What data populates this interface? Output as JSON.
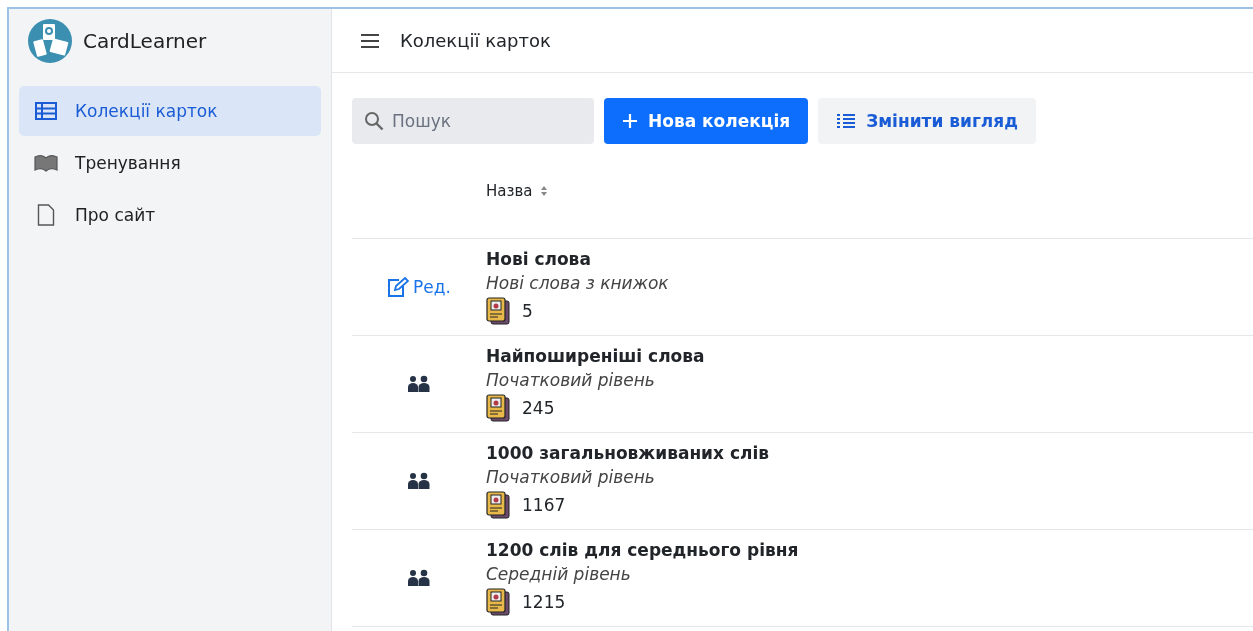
{
  "app": {
    "name": "CardLearner"
  },
  "sidebar": {
    "items": [
      {
        "label": "Колекції карток",
        "kind": "table",
        "selected": true
      },
      {
        "label": "Тренування",
        "kind": "book",
        "selected": false
      },
      {
        "label": "Про сайт",
        "kind": "page",
        "selected": false
      }
    ]
  },
  "header": {
    "title": "Колекції карток"
  },
  "toolbar": {
    "search": {
      "placeholder": "Пошук"
    },
    "new_button": "Нова колекція",
    "view_button": "Змінити вигляд"
  },
  "table": {
    "columns": [
      "Назва"
    ],
    "rows": [
      {
        "kind": "edit",
        "action": "Ред.",
        "title": "Нові слова",
        "subtitle": "Нові слова з книжок",
        "count": "5"
      },
      {
        "kind": "shared",
        "title": "Найпоширеніші слова",
        "subtitle": "Початковий рівень",
        "count": "245"
      },
      {
        "kind": "shared",
        "title": "1000 загальновживаних слів",
        "subtitle": "Початковий рівень",
        "count": "1167"
      },
      {
        "kind": "shared",
        "title": "1200 слів для середнього рівня",
        "subtitle": "Середній рівень",
        "count": "1215"
      }
    ]
  }
}
